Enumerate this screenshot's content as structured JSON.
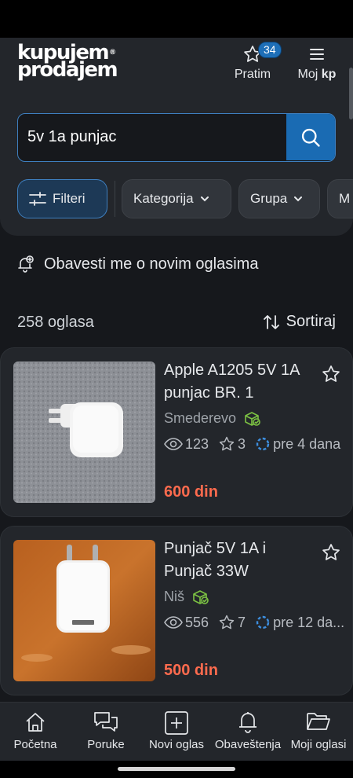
{
  "header": {
    "logo_line1": "kupujem",
    "logo_line2": "prodajem",
    "logo_reg": "®",
    "pratim_label": "Pratim",
    "pratim_badge": "34",
    "moj_label": "Moj",
    "moj_suffix": "kp"
  },
  "search": {
    "value": "5v 1a punjac",
    "placeholder": ""
  },
  "filters": {
    "filter_label": "Filteri",
    "category_label": "Kategorija",
    "group_label": "Grupa",
    "more_label": "M"
  },
  "notify": {
    "label": "Obavesti me o novim oglasima"
  },
  "results": {
    "count_label": "258 oglasa",
    "sort_label": "Sortiraj"
  },
  "listings": [
    {
      "title": "Apple A1205 5V 1A punjac BR. 1",
      "location": "Smederevo",
      "views": "123",
      "favorites": "3",
      "age": "pre 4 dana",
      "price": "600 din"
    },
    {
      "title": "Punjač 5V 1A i Punjač 33W",
      "location": "Niš",
      "views": "556",
      "favorites": "7",
      "age": "pre 12 da...",
      "price": "500 din"
    }
  ],
  "bottom_nav": [
    {
      "label": "Početna",
      "icon": "home-icon"
    },
    {
      "label": "Poruke",
      "icon": "messages-icon"
    },
    {
      "label": "Novi oglas",
      "icon": "add-icon"
    },
    {
      "label": "Obaveštenja",
      "icon": "bell-icon"
    },
    {
      "label": "Moji oglasi",
      "icon": "folder-icon"
    }
  ],
  "colors": {
    "accent": "#1a6bb3",
    "price": "#ff6b4e",
    "verified": "#7cc243",
    "background": "#16181c",
    "surface": "#23262b"
  }
}
